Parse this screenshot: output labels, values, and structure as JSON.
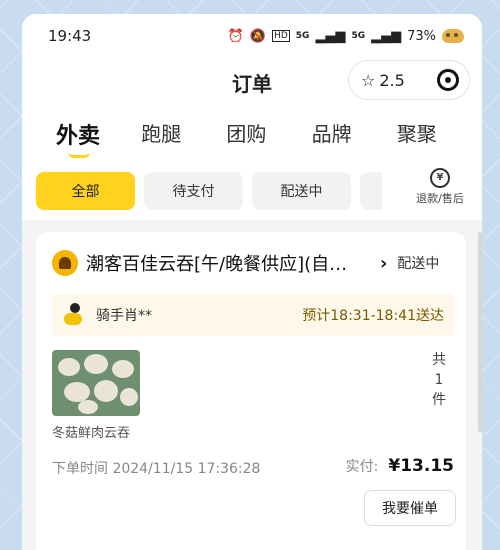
{
  "status_bar": {
    "time": "19:43",
    "signal1": "5G",
    "signal2": "5G",
    "battery": "73%"
  },
  "header": {
    "title": "订单",
    "rating": "2.5"
  },
  "tabs": [
    {
      "label": "外卖"
    },
    {
      "label": "跑腿"
    },
    {
      "label": "团购"
    },
    {
      "label": "品牌"
    },
    {
      "label": "聚聚"
    }
  ],
  "filters": [
    {
      "label": "全部"
    },
    {
      "label": "待支付"
    },
    {
      "label": "配送中"
    }
  ],
  "refund": {
    "label": "退款/售后",
    "icon_glyph": "¥"
  },
  "order": {
    "shop_name": "潮客百佳云吞[午/晚餐供应](自…",
    "status": "配送中",
    "rider_name": "骑手肖**",
    "eta": "预计18:31-18:41送达",
    "item_name": "冬菇鲜肉云吞",
    "count_prefix": "共",
    "count": "1",
    "count_suffix": "件",
    "order_time": "下单时间 2024/11/15 17:36:28",
    "pay_label": "实付:",
    "pay_amount": "¥13.15",
    "urge_button": "我要催单"
  },
  "colors": {
    "accent": "#ffd21e",
    "rider_bar": "#fdf8ea",
    "eta_text": "#7a5a00"
  }
}
